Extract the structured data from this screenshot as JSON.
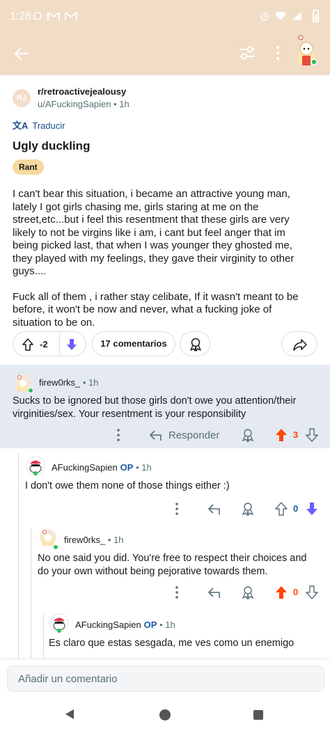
{
  "status_bar": {
    "time": "1:26"
  },
  "colors": {
    "header_bg": "#f1dcc6",
    "upvoted": "#ff4500",
    "downvote": "#6a5cff",
    "op_blue": "#1c5aa5",
    "highlight_bg": "#e4e9f2",
    "flair_bg": "#f5d9a0"
  },
  "header": {
    "icons": [
      "back-arrow-icon",
      "filter-icon",
      "more-vertical-icon",
      "user-avatar"
    ]
  },
  "post": {
    "subreddit_initials": "RJ",
    "subreddit": "r/retroactivejealousy",
    "author_meta": "u/AFuckingSapien • 1h",
    "translate_label": "Traducir",
    "title": "Ugly duckling",
    "flair": "Rant",
    "body_p1": "I can't bear this situation, i became an attractive young man, lately I got girls chasing me, girls staring at me on the street,etc...but i feel this resentment that these girls are very likely to not be virgins like i am, i cant but feel anger that im being picked last, that when I was younger they ghosted me, they played with my feelings, they gave their virginity to other guys....",
    "body_p2": "Fuck all of them , i rather stay celibate, If it wasn't meant to be before, it won't be now and never, what a fucking joke of situation to be on.",
    "score": "-2",
    "comments_label": "17 comentarios"
  },
  "comments": [
    {
      "user": "firew0rks_",
      "op": "",
      "time": " • 1h",
      "text": "Sucks to be ignored but those girls don't owe you attention/their virginities/sex. Your resentment is your responsibility",
      "reply_label": "Responder",
      "score": "3",
      "upvoted": true
    },
    {
      "user": "AFuckingSapien",
      "op": "OP",
      "time": " • 1h",
      "text": "I don't owe them none of those things either :)",
      "score": "0",
      "upvoted": false
    },
    {
      "user": "firew0rks_",
      "op": "",
      "time": " • 1h",
      "text": "No one said you did. You're free to respect their choices and do your own without being pejorative towards them.",
      "score": "0",
      "upvoted": true
    },
    {
      "user": "AFuckingSapien",
      "op": "OP",
      "time": " • 1h",
      "text": "Es claro que estas sesgada, me ves como un enemigo"
    }
  ],
  "composer": {
    "placeholder": "Añadir un comentario"
  }
}
